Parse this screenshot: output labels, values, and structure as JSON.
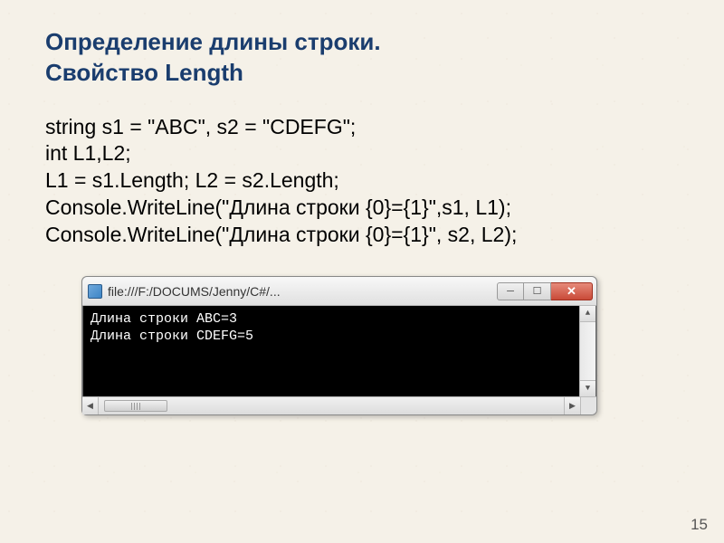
{
  "heading_line1": "Определение длины строки.",
  "heading_line2": "Свойство Length",
  "code": {
    "l1": "string s1 = \"ABC\", s2 = \"CDEFG\";",
    "l2": "int L1,L2;",
    "l3": "L1 = s1.Length; L2 = s2.Length;",
    "l4": "Console.WriteLine(\"Длина строки {0}={1}\",s1, L1);",
    "l5": "Console.WriteLine(\"Длина строки {0}={1}\", s2, L2);"
  },
  "console": {
    "title": "file:///F:/DOCUMS/Jenny/C#/...",
    "out1": "Длина строки ABC=3",
    "out2": "Длина строки CDEFG=5"
  },
  "page_number": "15"
}
